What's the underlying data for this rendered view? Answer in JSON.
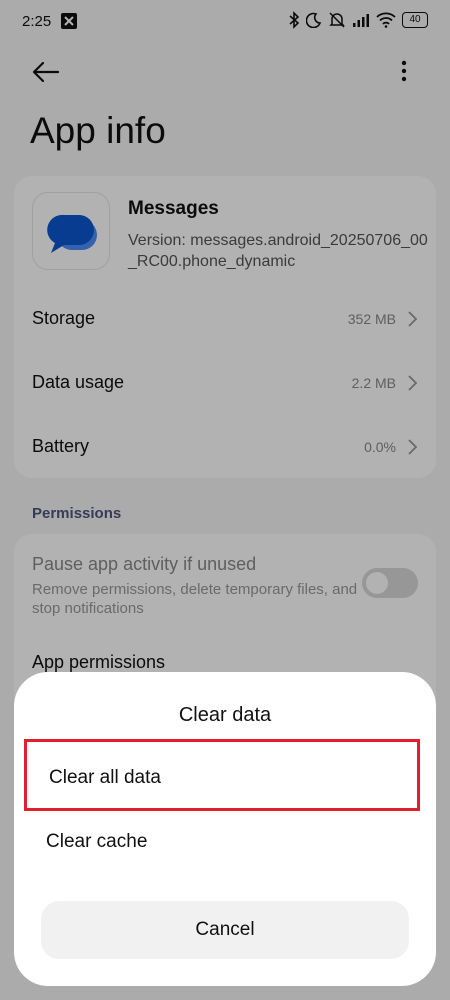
{
  "status_bar": {
    "time": "2:25",
    "battery": "40"
  },
  "page": {
    "title": "App info"
  },
  "app": {
    "name": "Messages",
    "version": "Version: messages.android_20250706_00_RC00.phone_dynamic"
  },
  "info_rows": [
    {
      "label": "Storage",
      "value": "352 MB"
    },
    {
      "label": "Data usage",
      "value": "2.2 MB"
    },
    {
      "label": "Battery",
      "value": "0.0%"
    }
  ],
  "permissions": {
    "section_title": "Permissions",
    "pause_title": "Pause app activity if unused",
    "pause_desc": "Remove permissions, delete temporary files, and stop notifications",
    "app_permissions": "App permissions"
  },
  "sheet": {
    "title": "Clear data",
    "options": [
      {
        "label": "Clear all data"
      },
      {
        "label": "Clear cache"
      }
    ],
    "cancel": "Cancel"
  },
  "colors": {
    "highlight": "#e0202c",
    "icon_blue_dark": "#0b57d0",
    "icon_blue_light": "#4c8df6",
    "section_title": "#4d5680"
  }
}
